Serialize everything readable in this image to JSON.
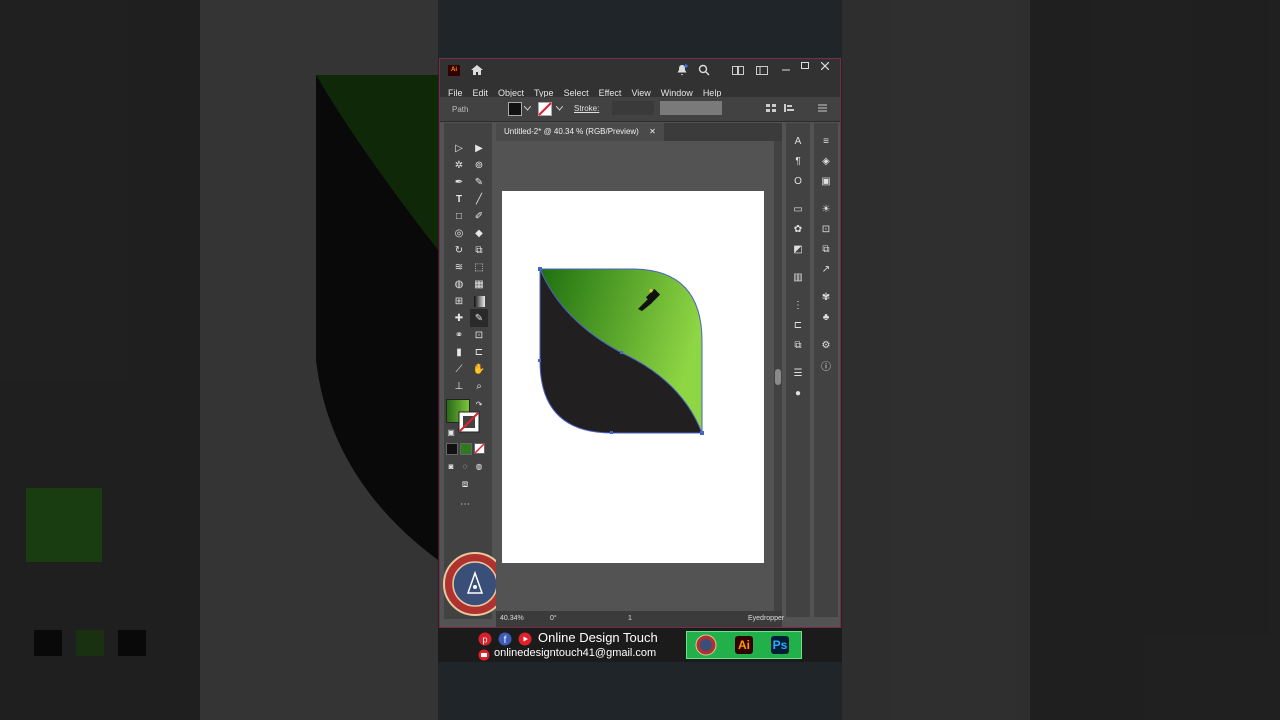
{
  "app": {
    "logo": "Ai",
    "menu": [
      "File",
      "Edit",
      "Object",
      "Type",
      "Select",
      "Effect",
      "View",
      "Window",
      "Help"
    ],
    "control_bar": {
      "selection_type": "Path",
      "stroke_label": "Stroke:"
    },
    "document_tab": "Untitled-2* @ 40.34 % (RGB/Preview)",
    "status": {
      "zoom": "40.34%",
      "rotation": "0°",
      "artboard": "1",
      "tool": "Eyedropper"
    }
  },
  "colors": {
    "leaf_dark": "#221f20",
    "leaf_green_start": "#1e6f10",
    "leaf_green_end": "#8fd644",
    "accent": "#22b04a"
  },
  "banner": {
    "name": "Online Design Touch",
    "email": "onlinedesigntouch41@gmail.com",
    "apps": [
      "Ai",
      "Ps"
    ]
  },
  "icons": [
    "home-icon",
    "bell-icon",
    "search-icon",
    "eyedropper-icon",
    "pinterest-icon",
    "facebook-icon",
    "youtube-icon",
    "email-icon"
  ]
}
